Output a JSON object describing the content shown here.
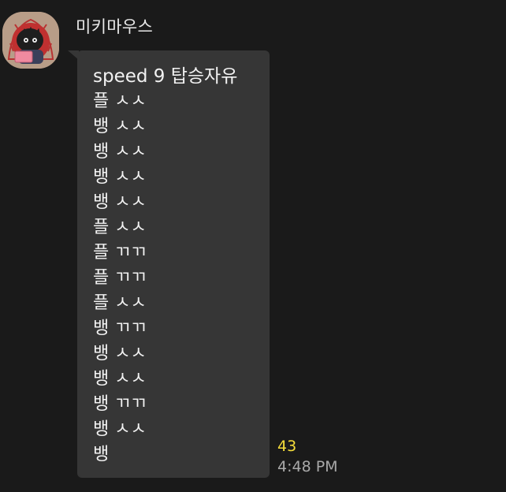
{
  "message": {
    "sender": "미키마우스",
    "lines": [
      "speed 9 탑승자유",
      "플 ㅅㅅ",
      "뱅 ㅅㅅ",
      "뱅 ㅅㅅ",
      "뱅 ㅅㅅ",
      "뱅 ㅅㅅ",
      "플 ㅅㅅ",
      "플 ㄲㄲ",
      "플 ㄲㄲ",
      "플 ㅅㅅ",
      "뱅 ㄲㄲ",
      "뱅 ㅅㅅ",
      "뱅 ㅅㅅ",
      "뱅 ㄲㄲ",
      "뱅 ㅅㅅ",
      "뱅"
    ],
    "unread_count": "43",
    "time": "4:48 PM"
  },
  "avatar": {
    "icon": "cartoon-character-avatar-icon"
  },
  "colors": {
    "background": "#1a1a1a",
    "bubble": "#363636",
    "text": "#f2f2f2",
    "unread": "#f5dd3a",
    "time": "#a9a9a9"
  }
}
